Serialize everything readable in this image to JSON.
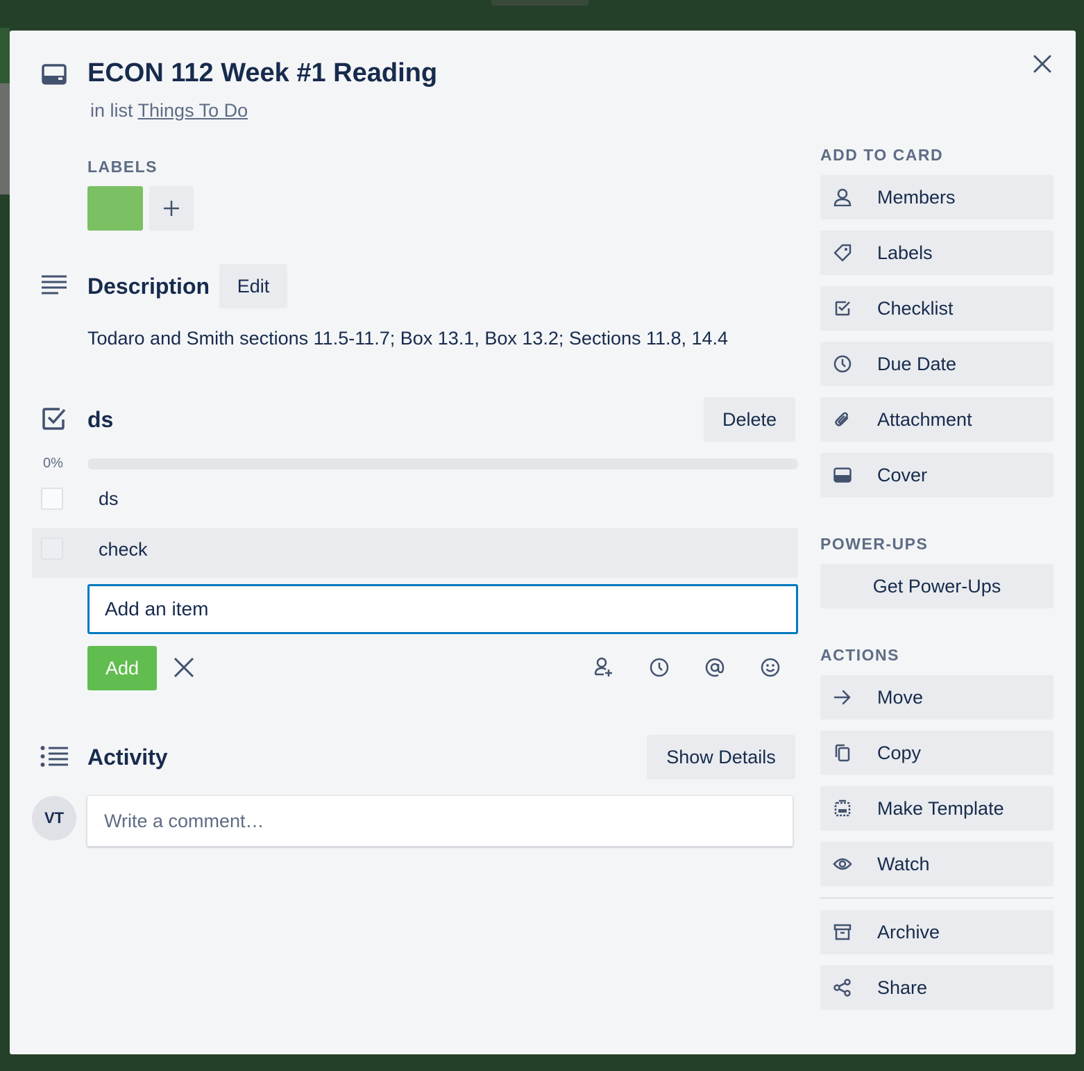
{
  "card": {
    "title": "ECON 112 Week #1 Reading",
    "in_list_prefix": "in list",
    "list_name": "Things To Do"
  },
  "labels": {
    "heading": "LABELS",
    "items": [
      {
        "color": "#7bc062"
      }
    ],
    "add_icon": "plus-icon"
  },
  "description": {
    "heading": "Description",
    "edit_label": "Edit",
    "text": "Todaro and Smith sections 11.5-11.7; Box 13.1, Box 13.2; Sections 11.8, 14.4"
  },
  "checklist": {
    "title": "ds",
    "delete_label": "Delete",
    "progress_text": "0%",
    "progress": 0,
    "items": [
      {
        "text": "ds",
        "checked": false
      },
      {
        "text": "check",
        "checked": false
      }
    ],
    "add_input_value": "Add an item",
    "add_label": "Add",
    "tool_icons": [
      "add-member-icon",
      "clock-icon",
      "mention-icon",
      "emoji-icon"
    ]
  },
  "activity": {
    "heading": "Activity",
    "show_details_label": "Show Details",
    "avatar_initials": "VT",
    "comment_placeholder": "Write a comment…"
  },
  "sidebar": {
    "add_to_card_heading": "ADD TO CARD",
    "add_to_card": [
      {
        "label": "Members",
        "icon": "person-icon"
      },
      {
        "label": "Labels",
        "icon": "tag-icon"
      },
      {
        "label": "Checklist",
        "icon": "checkbox-icon"
      },
      {
        "label": "Due Date",
        "icon": "clock-icon"
      },
      {
        "label": "Attachment",
        "icon": "paperclip-icon"
      },
      {
        "label": "Cover",
        "icon": "cover-icon"
      }
    ],
    "power_ups_heading": "POWER-UPS",
    "get_power_ups_label": "Get Power-Ups",
    "actions_heading": "ACTIONS",
    "actions": [
      {
        "label": "Move",
        "icon": "arrow-right-icon"
      },
      {
        "label": "Copy",
        "icon": "copy-icon"
      },
      {
        "label": "Make Template",
        "icon": "template-icon"
      },
      {
        "label": "Watch",
        "icon": "eye-icon"
      }
    ],
    "archive_actions": [
      {
        "label": "Archive",
        "icon": "archive-icon"
      },
      {
        "label": "Share",
        "icon": "share-icon"
      }
    ]
  },
  "colors": {
    "accent_blue": "#0079bf",
    "add_green": "#61bd4f",
    "label_green": "#7bc062",
    "modal_bg": "#f4f5f7",
    "backdrop": "#254028"
  }
}
